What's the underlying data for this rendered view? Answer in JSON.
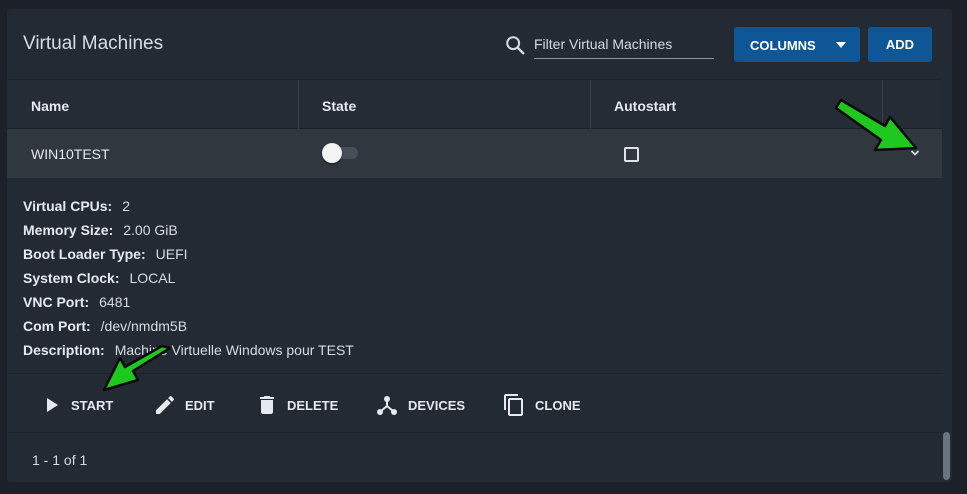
{
  "header": {
    "title": "Virtual Machines",
    "search_placeholder": "Filter Virtual Machines",
    "columns_label": "COLUMNS",
    "add_label": "ADD"
  },
  "table": {
    "columns": [
      "Name",
      "State",
      "Autostart"
    ]
  },
  "row": {
    "name": "WIN10TEST",
    "state_on": false,
    "autostart_checked": false
  },
  "details": [
    {
      "label": "Virtual CPUs:",
      "value": "2"
    },
    {
      "label": "Memory Size:",
      "value": "2.00 GiB"
    },
    {
      "label": "Boot Loader Type:",
      "value": "UEFI"
    },
    {
      "label": "System Clock:",
      "value": "LOCAL"
    },
    {
      "label": "VNC Port:",
      "value": "6481"
    },
    {
      "label": "Com Port:",
      "value": "/dev/nmdm5B"
    },
    {
      "label": "Description:",
      "value": "Machine Virtuelle Windows pour TEST"
    }
  ],
  "actions": {
    "start": "START",
    "edit": "EDIT",
    "delete": "DELETE",
    "devices": "DEVICES",
    "clone": "CLONE"
  },
  "footer": {
    "pagination": "1 - 1 of 1"
  },
  "colors": {
    "background": "#1c2028",
    "card": "#242a33",
    "accent": "#0e5695",
    "arrow": "#1ec81e"
  }
}
